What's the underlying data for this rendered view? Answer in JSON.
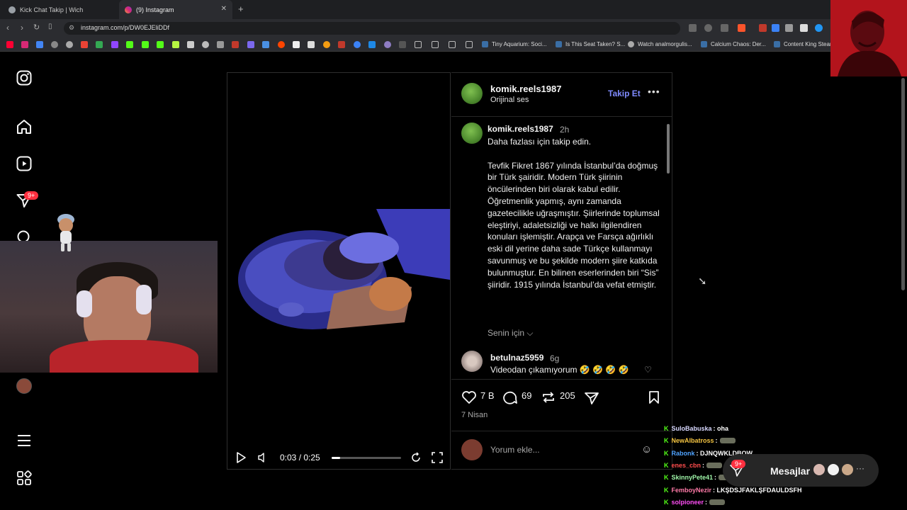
{
  "browser": {
    "tabs": [
      {
        "title": "Kick Chat Takip | Wich",
        "active": false
      },
      {
        "title": "(9) Instagram",
        "active": true
      }
    ],
    "url": "instagram.com/p/DW0EJEliDDf",
    "bookmarks": [
      "Tiny Aquarium: Soci...",
      "Is This Seat Taken? S...",
      "Watch analmorgulis...",
      "Calcium Chaos: Der...",
      "Content King Steam"
    ]
  },
  "nav": {
    "notification_badge": "9+"
  },
  "video": {
    "time": "0:03 / 0:25",
    "progress": 0.12
  },
  "post": {
    "username": "komik.reels1987",
    "audio": "Orijinal ses",
    "follow_label": "Takip Et",
    "more_label": "•••",
    "caption_user": "komik.reels1987",
    "caption_time": "2h",
    "caption_text": "Daha fazlası için takip edin.\n\nTevfik Fikret 1867 yılında İstanbul’da doğmuş bir Türk şairidir. Modern Türk şiirinin öncülerinden biri olarak kabul edilir. Öğretmenlik yapmış, aynı zamanda gazetecilikle uğraşmıştır. Şiirlerinde toplumsal eleştiriyi, adaletsizliği ve halkı ilgilendiren konuları işlemiştir. Arapça ve Farsça ağırlıklı eski dil yerine daha sade Türkçe kullanmayı savunmuş ve bu şekilde modern şiire katkıda bulunmuştur. En bilinen eserlerinden biri “Sis” şiiridir. 1915 yılında İstanbul’da vefat etmiştir.",
    "for_you_label": "Senin için",
    "comment": {
      "user": "betulnaz5959",
      "time": "6g",
      "text": "Videodan çıkamıyorum 🤣 🤣 🤣 🤣"
    },
    "likes": "7 B",
    "comments_count": "69",
    "reposts": "205",
    "date": "7 Nisan",
    "comment_placeholder": "Yorum ekle..."
  },
  "chat": [
    {
      "user": "SuloBabuska",
      "color": "#d8d8ff",
      "message": ": oha",
      "emote": false
    },
    {
      "user": "NewAlbatross",
      "color": "#f5c542",
      "message": ":",
      "emote": true
    },
    {
      "user": "Rabonk",
      "color": "#4fa3ff",
      "message": ": DJNQWKLDBQW",
      "emote": false
    },
    {
      "user": "enes_cbn",
      "color": "#ff4d4d",
      "message": ":",
      "emote": true
    },
    {
      "user": "SkinnyPete41",
      "color": "#9ff5a8",
      "message": ":",
      "emote": true
    },
    {
      "user": "FemboyNezir",
      "color": "#ff7aa8",
      "message": ": LKŞDSJFAKLŞFDAULDSFH",
      "emote": false
    },
    {
      "user": "solpioneer",
      "color": "#ff4df5",
      "message": ":",
      "emote": true
    }
  ],
  "messages": {
    "label": "Mesajlar",
    "badge": "9+"
  },
  "colors": {
    "background": "#000000",
    "accent_link": "#7f8bff",
    "badge_red": "#ff3040",
    "kick_green": "#53fc18"
  }
}
